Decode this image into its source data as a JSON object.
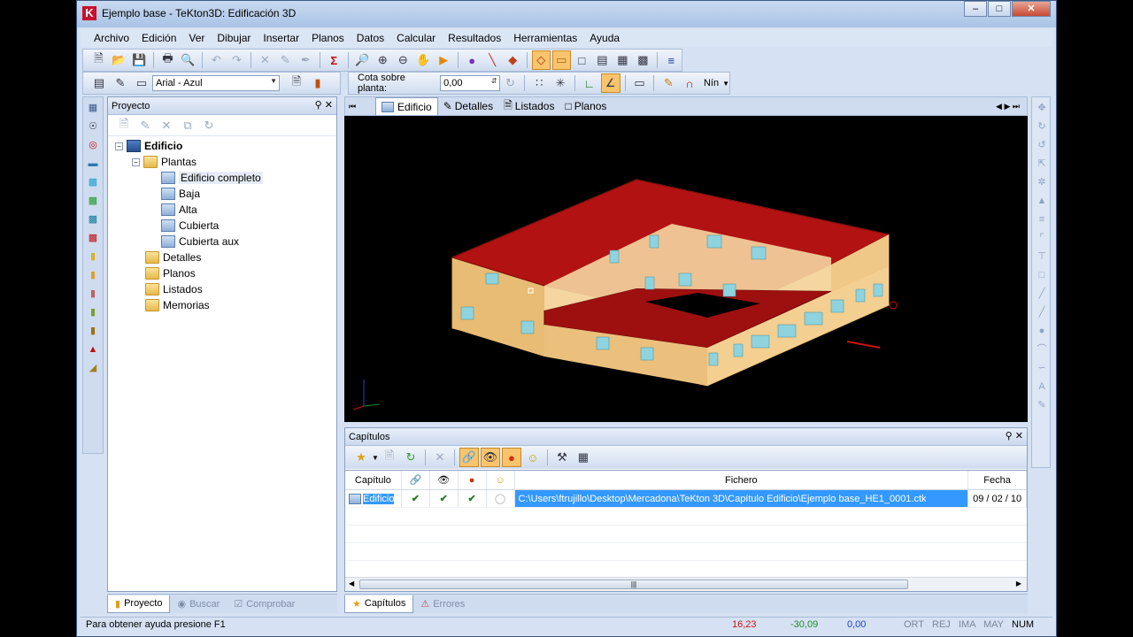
{
  "window": {
    "title": "Ejemplo base - TeKton3D: Edificación 3D",
    "logo": "K"
  },
  "menu": [
    "Archivo",
    "Edición",
    "Ver",
    "Dibujar",
    "Insertar",
    "Planos",
    "Datos",
    "Calcular",
    "Resultados",
    "Herramientas",
    "Ayuda"
  ],
  "toolbar2": {
    "style_combo": "Arial - Azul",
    "cota_label": "Cota sobre planta:",
    "cota_value": "0,00",
    "nin_label": "Nín"
  },
  "project_panel": {
    "title": "Proyecto",
    "tree": {
      "root": "Edificio",
      "plantas": "Plantas",
      "levels": [
        "Edificio completo",
        "Baja",
        "Alta",
        "Cubierta",
        "Cubierta aux"
      ],
      "folders": [
        "Detalles",
        "Planos",
        "Listados",
        "Memorias"
      ]
    },
    "tabs": [
      "Proyecto",
      "Buscar",
      "Comprobar"
    ]
  },
  "doc_tabs": [
    "Edificio",
    "Detalles",
    "Listados",
    "Planos"
  ],
  "capitulos_panel": {
    "title": "Capítulos",
    "columns": {
      "capitulo": "Capítulo",
      "fichero": "Fichero",
      "fecha": "Fecha"
    },
    "rows": [
      {
        "capitulo": "Edificio",
        "fichero": "C:\\Users\\ftrujillo\\Desktop\\Mercadona\\TeKton 3D\\Capítulo Edificio\\Ejemplo base_HE1_0001.ctk",
        "fecha": "09 / 02 / 10"
      }
    ],
    "tabs": [
      "Capítulos",
      "Errores"
    ]
  },
  "status": {
    "help": "Para obtener ayuda presione F1",
    "x": "16,23",
    "y": "-30,09",
    "z": "0,00",
    "flags": [
      "ORT",
      "REJ",
      "IMA",
      "MAY",
      "NUM"
    ]
  },
  "colors": {
    "roof": "#b31212",
    "wall": "#f0c98a",
    "window": "#8fd3de",
    "x_coord": "#d01010",
    "y_coord": "#1f8a2a",
    "z_coord": "#1f3fd0"
  }
}
